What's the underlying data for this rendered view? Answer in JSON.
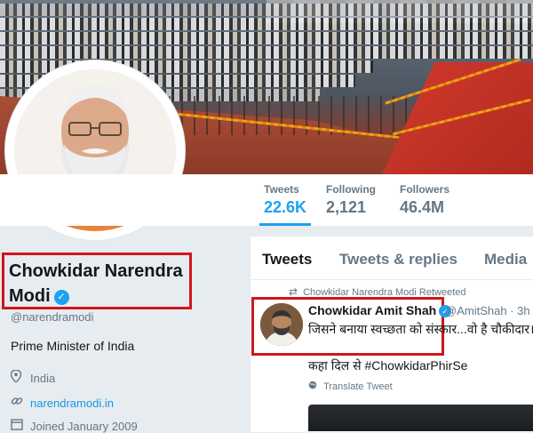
{
  "stats": {
    "tweets": {
      "label": "Tweets",
      "value": "22.6K"
    },
    "following": {
      "label": "Following",
      "value": "2,121"
    },
    "followers": {
      "label": "Followers",
      "value": "46.4M"
    }
  },
  "profile": {
    "name_line1": "Chowkidar Narendra",
    "name_line2": "Modi",
    "handle": "@narendramodi",
    "bio": "Prime Minister of India",
    "location": "India",
    "website": "narendramodi.in",
    "joined": "Joined January 2009",
    "verified_icon": "verified-badge-icon"
  },
  "tabs": [
    {
      "label": "Tweets"
    },
    {
      "label": "Tweets & replies"
    },
    {
      "label": "Media"
    }
  ],
  "tweet": {
    "retweet_context": "Chowkidar Narendra Modi Retweeted",
    "author": "Chowkidar Amit Shah",
    "handle_time": "@AmitShah · 3h",
    "text_line1": "जिसने बनाया स्वच्छता को संस्कार...वो है चौकीदार।",
    "text_line2": "कहा दिल से #ChowkidarPhirSe",
    "translate": "Translate Tweet"
  },
  "colors": {
    "accent": "#1da1f2",
    "highlight_box": "#d0161d",
    "background": "#e6ecf0"
  }
}
